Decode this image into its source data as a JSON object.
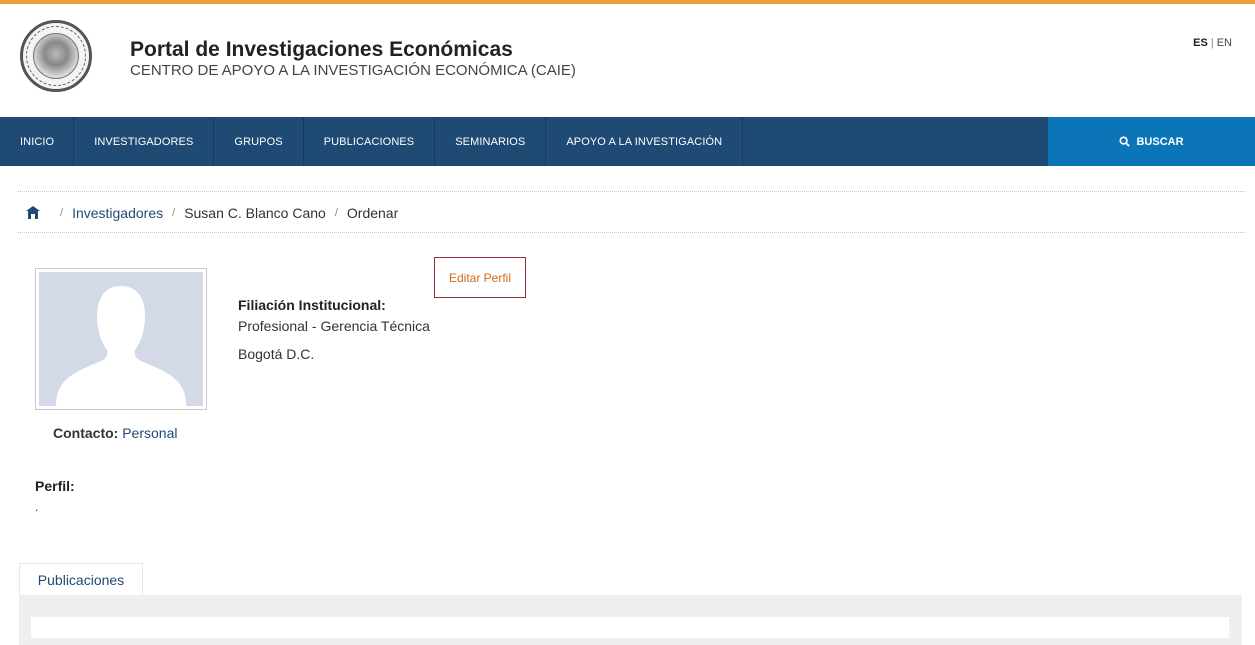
{
  "header": {
    "title": "Portal de Investigaciones Económicas",
    "subtitle": "CENTRO DE APOYO A LA INVESTIGACIÓN ECONÓMICA (CAIE)",
    "lang_es": "ES",
    "lang_sep": "|",
    "lang_en": "EN",
    "seal_text": "BANCO DE LA REPÚBLICA · COLOMBIA",
    "accent_color": "#e8a33d"
  },
  "nav": {
    "items": [
      {
        "label": "INICIO"
      },
      {
        "label": "INVESTIGADORES"
      },
      {
        "label": "GRUPOS"
      },
      {
        "label": "PUBLICACIONES"
      },
      {
        "label": "SEMINARIOS"
      },
      {
        "label": "APOYO A LA INVESTIGACIÓN"
      }
    ],
    "search_label": "BUSCAR",
    "search_icon": "search-icon",
    "bg_color": "#1f4a73",
    "search_bg_color": "#0b75b8"
  },
  "breadcrumb": {
    "home_icon": "home-icon",
    "items": [
      "Investigadores",
      "Susan C. Blanco Cano",
      "Ordenar"
    ],
    "separator": "/"
  },
  "profile": {
    "edit_label": "Editar Perfil",
    "affiliation_heading": "Filiación Institucional:",
    "affiliation_role": "Profesional - Gerencia Técnica",
    "affiliation_city": "Bogotá D.C.",
    "contact_label": "Contacto:",
    "contact_link": "Personal",
    "perfil_heading": "Perfil:",
    "perfil_value": "."
  },
  "tabs": {
    "items": [
      {
        "label": "Publicaciones"
      }
    ]
  }
}
